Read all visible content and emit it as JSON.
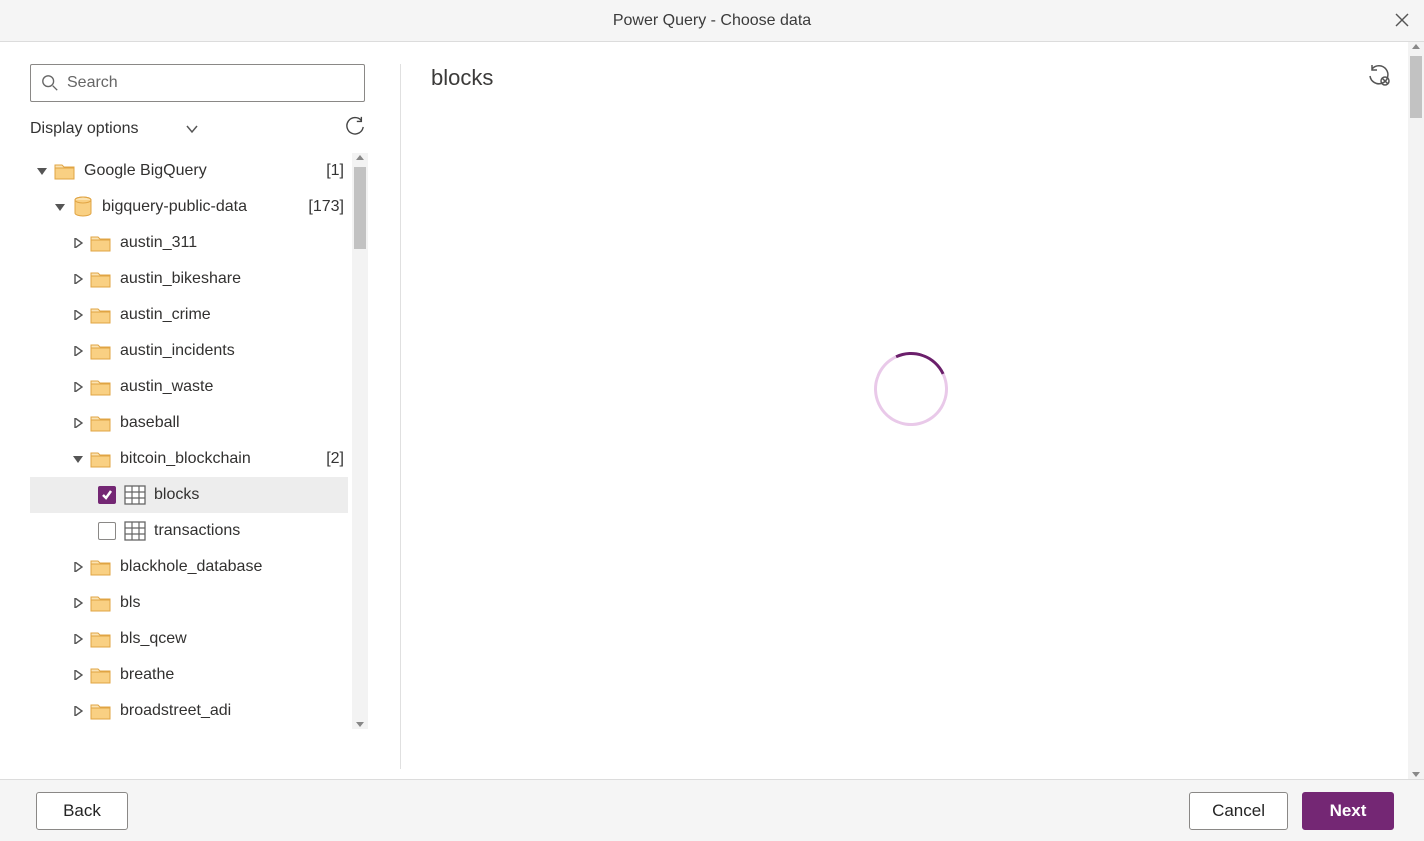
{
  "window": {
    "title": "Power Query - Choose data"
  },
  "search": {
    "placeholder": "Search"
  },
  "displayOptions": {
    "label": "Display options"
  },
  "tree": {
    "root": {
      "label": "Google BigQuery",
      "count": "[1]"
    },
    "project": {
      "label": "bigquery-public-data",
      "count": "[173]"
    },
    "datasets": [
      {
        "label": "austin_311"
      },
      {
        "label": "austin_bikeshare"
      },
      {
        "label": "austin_crime"
      },
      {
        "label": "austin_incidents"
      },
      {
        "label": "austin_waste"
      },
      {
        "label": "baseball"
      }
    ],
    "openDataset": {
      "label": "bitcoin_blockchain",
      "count": "[2]"
    },
    "tables": [
      {
        "label": "blocks",
        "checked": true
      },
      {
        "label": "transactions",
        "checked": false
      }
    ],
    "tailDatasets": [
      {
        "label": "blackhole_database"
      },
      {
        "label": "bls"
      },
      {
        "label": "bls_qcew"
      },
      {
        "label": "breathe"
      },
      {
        "label": "broadstreet_adi"
      }
    ]
  },
  "preview": {
    "title": "blocks"
  },
  "footer": {
    "back": "Back",
    "cancel": "Cancel",
    "next": "Next"
  }
}
